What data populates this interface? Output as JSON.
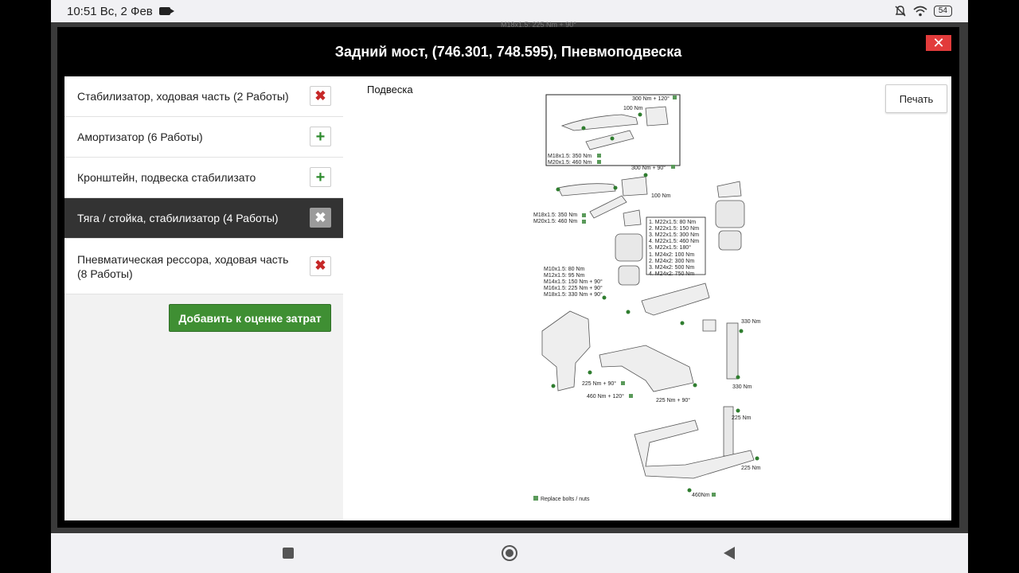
{
  "status": {
    "time": "10:51 Вс, 2 Фев",
    "battery": "54"
  },
  "background": {
    "ghost_text": "M18x1.5: 225 Nm + 90°"
  },
  "dialog": {
    "title": "Задний мост, (746.301, 748.595), Пневмоподвеска",
    "close_label": "✕"
  },
  "items": [
    {
      "label": "Стабилизатор, ходовая часть (2 Работы)",
      "action": "✖"
    },
    {
      "label": "Амортизатор (6 Работы)",
      "action": "+"
    },
    {
      "label": "Кронштейн, подвеска стабилизато",
      "action": "+"
    },
    {
      "label": "Тяга / стойка, стабилизатор (4 Работы)",
      "action": "✖"
    },
    {
      "label": "Пневматическая рессора, ходовая часть (8 Работы)",
      "action": "✖"
    }
  ],
  "add_estimate_label": "Добавить к оценке затрат",
  "diagram": {
    "title": "Подвеска",
    "print_label": "Печать",
    "texts": {
      "t1": "300 Nm + 120°",
      "t2": "100 Nm",
      "t3": "M18x1.5: 350 Nm",
      "t4": "M20x1.5: 460 Nm",
      "t5": "300 Nm + 90°",
      "t6": "100 Nm",
      "t7": "M18x1.5: 350 Nm",
      "t8": "M20x1.5: 460 Nm",
      "t9": "1. M22x1.5: 80 Nm",
      "t10": "2. M22x1.5: 150 Nm",
      "t11": "3. M22x1.5: 300 Nm",
      "t12": "4. M22x1.5: 460 Nm",
      "t13": "5. M22x1.5: 180°",
      "t14": "1. M24x2: 100 Nm",
      "t15": "2. M24x2: 300 Nm",
      "t16": "3. M24x2: 500 Nm",
      "t17": "4. M24x2: 750 Nm",
      "t18": "M10x1.5: 80 Nm",
      "t19": "M12x1.5: 95 Nm",
      "t20": "M14x1.5: 150 Nm + 90°",
      "t21": "M16x1.5: 225 Nm + 90°",
      "t22": "M18x1.5: 330 Nm + 90°",
      "t23": "330 Nm",
      "t24": "330 Nm",
      "t25": "225 Nm + 90°",
      "t26": "460 Nm + 120°",
      "t27": "225 Nm + 90°",
      "t28": "225 Nm",
      "t29": "225 Nm",
      "t30": "460Nm",
      "t31": "Replace bolts / nuts"
    }
  }
}
